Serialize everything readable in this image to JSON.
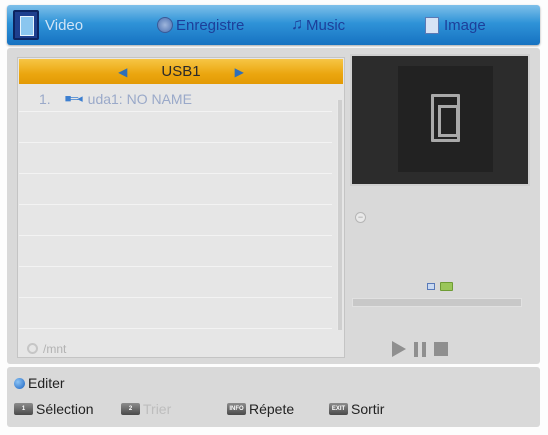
{
  "tabs": [
    {
      "id": "video",
      "label": "Video",
      "icon": "film-icon",
      "active": true
    },
    {
      "id": "record",
      "label": "Enregistre",
      "icon": "record-icon"
    },
    {
      "id": "music",
      "label": "Music",
      "icon": "music-note-icon"
    },
    {
      "id": "image",
      "label": "Image",
      "icon": "image-icon"
    }
  ],
  "filelist": {
    "device": "USB1",
    "items": [
      {
        "index": "1.",
        "name": "uda1: NO NAME",
        "icon": "usb-icon"
      }
    ],
    "path": "/mnt"
  },
  "player": {
    "progress_fraction": 0.0,
    "controls": [
      "play",
      "pause",
      "stop"
    ]
  },
  "help": {
    "edit": {
      "label": "Editer",
      "key": "blue-button"
    },
    "select": {
      "key": "1",
      "label": "Sélection"
    },
    "sort": {
      "key": "2",
      "label": "Trier"
    },
    "repeat": {
      "key": "INFO",
      "label": "Répete"
    },
    "exit": {
      "key": "EXIT",
      "label": "Sortir"
    }
  },
  "colors": {
    "tabbar": "#2f93d8",
    "header_highlight": "#eba60f",
    "panel": "#d9d9d9",
    "inactive_text": "#9aa9c9"
  }
}
